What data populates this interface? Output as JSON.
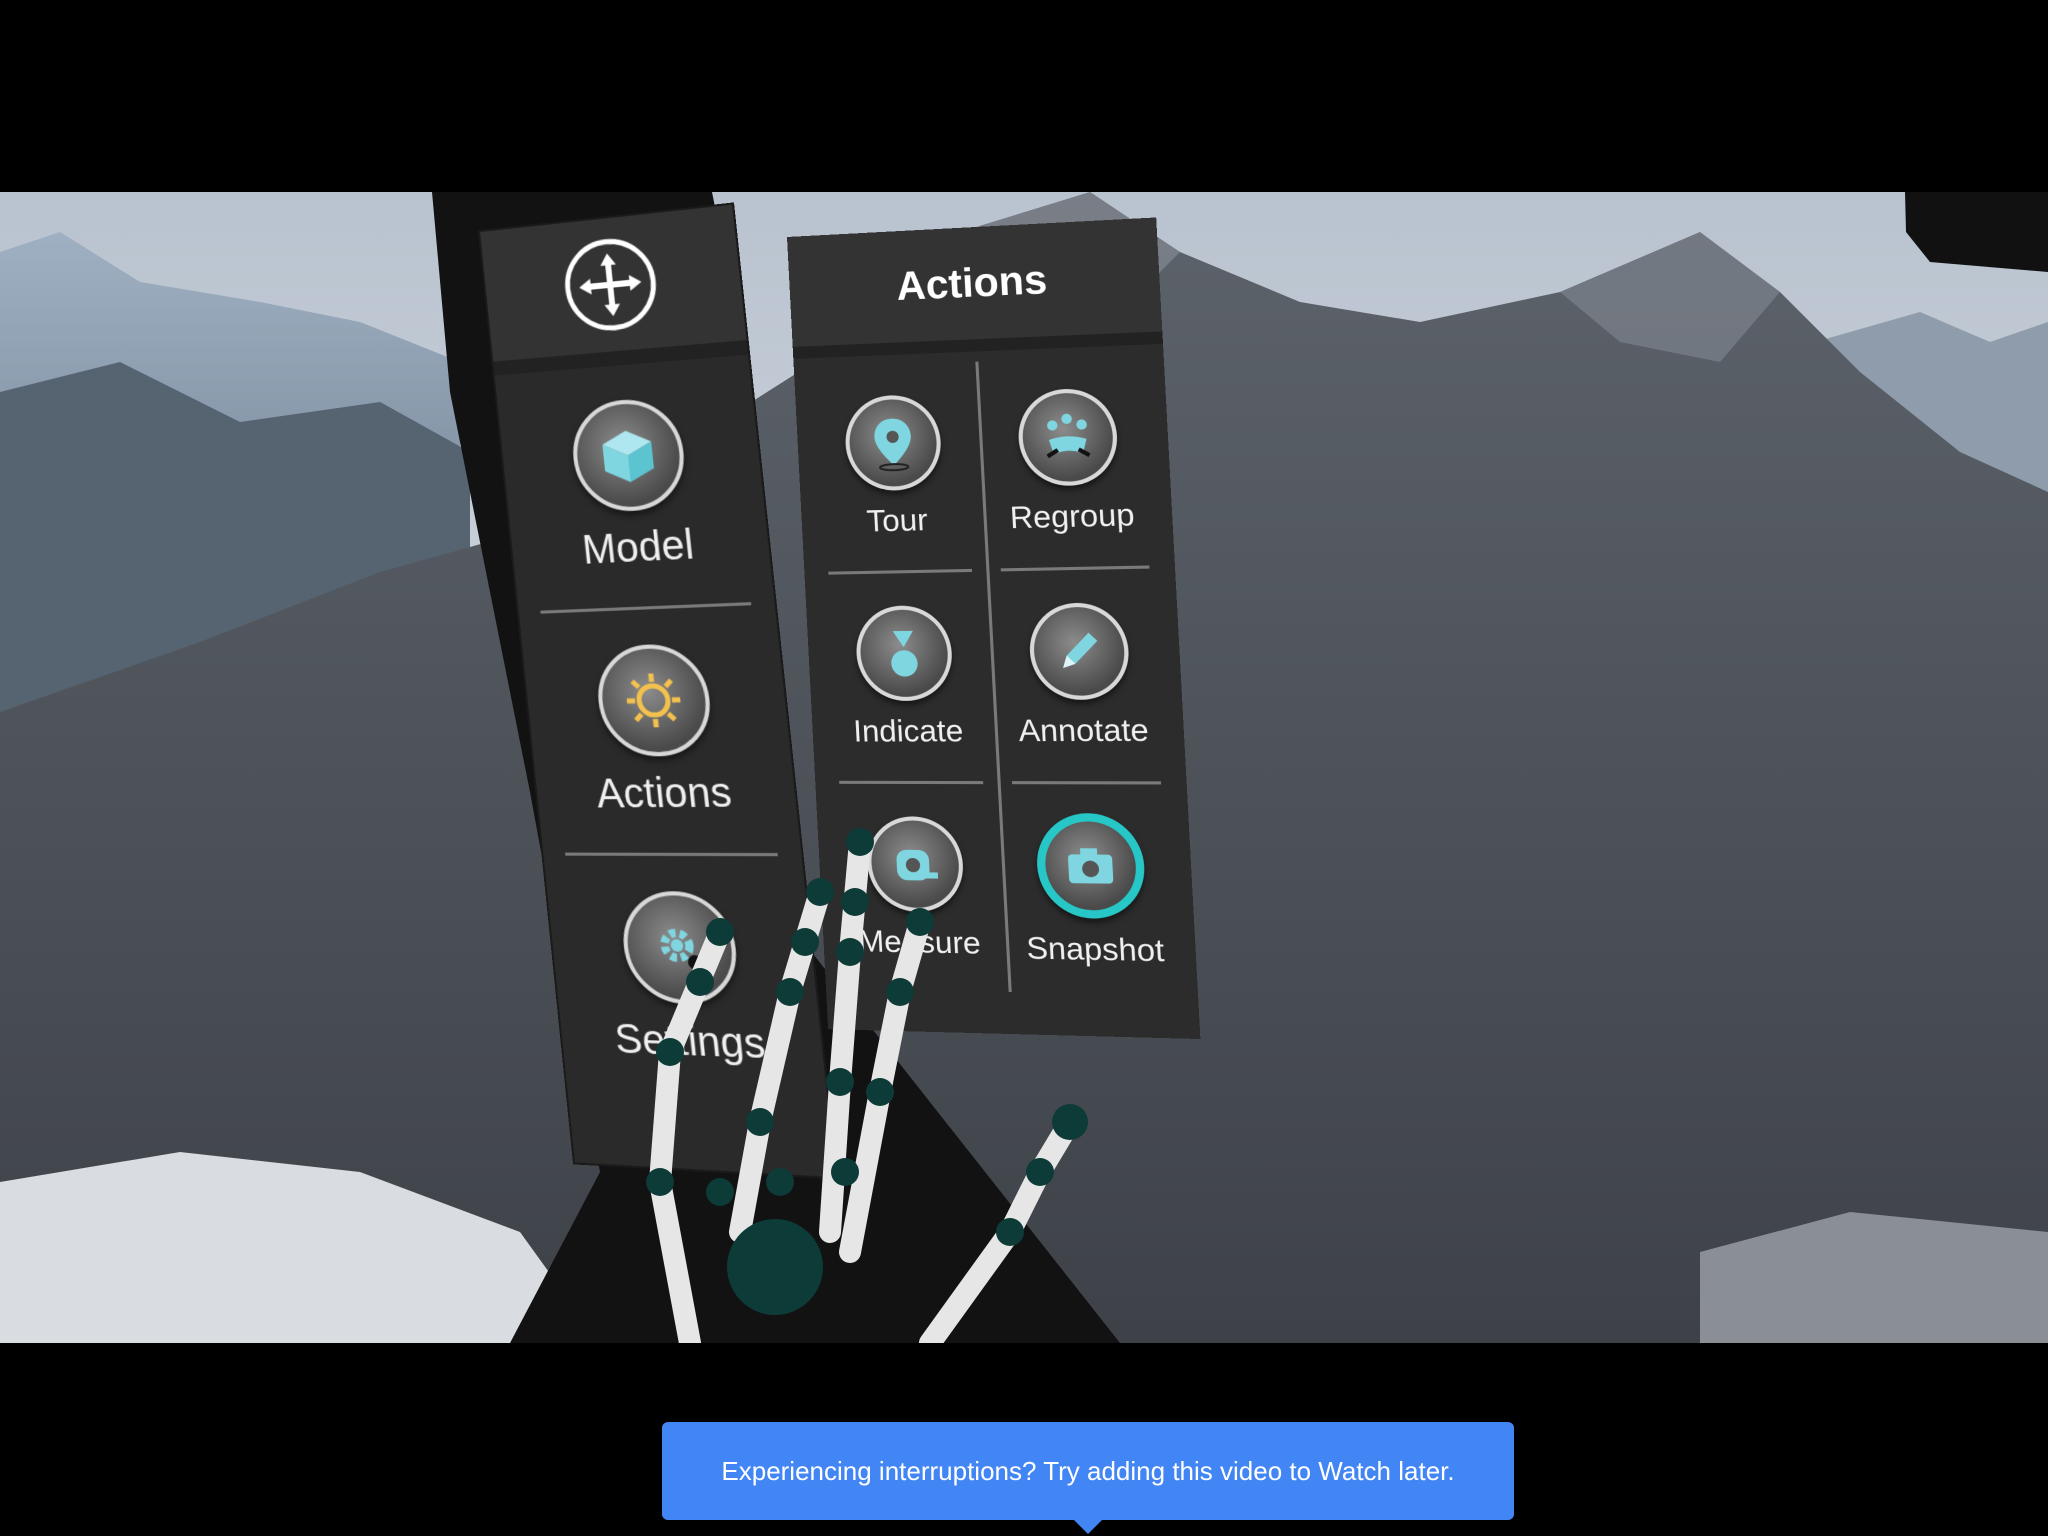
{
  "nav_panel": {
    "items": [
      {
        "label": "Model",
        "icon": "cube-icon"
      },
      {
        "label": "Actions",
        "icon": "sun-gear-icon"
      },
      {
        "label": "Settings",
        "icon": "gear-icon"
      }
    ],
    "move_icon": "move-arrows-icon"
  },
  "actions_panel": {
    "title": "Actions",
    "items": [
      {
        "label": "Tour",
        "icon": "location-pin-icon"
      },
      {
        "label": "Regroup",
        "icon": "regroup-icon"
      },
      {
        "label": "Indicate",
        "icon": "indicate-icon"
      },
      {
        "label": "Annotate",
        "icon": "pencil-icon"
      },
      {
        "label": "Measure",
        "icon": "tape-measure-icon"
      },
      {
        "label": "Snapshot",
        "icon": "camera-icon",
        "active": true
      }
    ]
  },
  "tooltip": {
    "text": "Experiencing interruptions? Try adding this video to Watch later."
  },
  "colors": {
    "accent_teal": "#28c7c7",
    "icon_cyan": "#7fd6e0",
    "tooltip_blue": "#4285f4"
  }
}
